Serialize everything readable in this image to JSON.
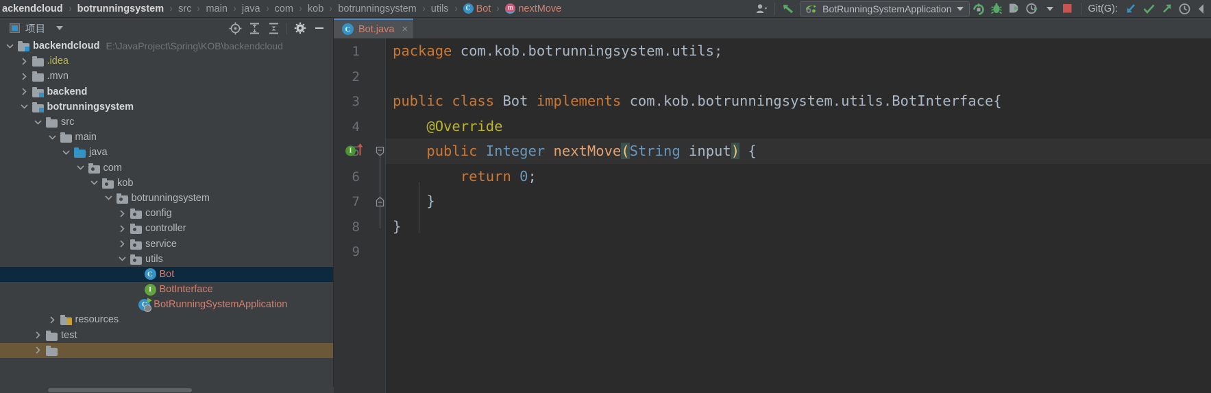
{
  "breadcrumb": {
    "items": [
      {
        "label": "ackendcloud",
        "style": "bold",
        "icon": null
      },
      {
        "label": "botrunningsystem",
        "style": "bold",
        "icon": null
      },
      {
        "label": "src",
        "style": "plain",
        "icon": null
      },
      {
        "label": "main",
        "style": "plain",
        "icon": null
      },
      {
        "label": "java",
        "style": "plain",
        "icon": null
      },
      {
        "label": "com",
        "style": "plain",
        "icon": null
      },
      {
        "label": "kob",
        "style": "plain",
        "icon": null
      },
      {
        "label": "botrunningsystem",
        "style": "plain",
        "icon": null
      },
      {
        "label": "utils",
        "style": "plain",
        "icon": null
      },
      {
        "label": "Bot",
        "style": "file",
        "icon": "class-icon"
      },
      {
        "label": "nextMove",
        "style": "method",
        "icon": "method-icon"
      }
    ],
    "separator": "›"
  },
  "toolbar": {
    "icons": [
      "user-avatar-icon",
      "dropdown-caret-icon",
      "update-project-icon"
    ],
    "run_config": {
      "name": "BotRunningSystemApplication",
      "icon": "spring-boot-icon"
    },
    "actions": [
      "run-icon",
      "debug-icon",
      "run-with-coverage-icon",
      "profile-icon",
      "profile-caret-icon",
      "stop-icon"
    ],
    "git_label": "Git(G):",
    "git_actions": [
      "update-project-icon",
      "commit-icon",
      "push-icon",
      "history-icon",
      "rollback-icon"
    ]
  },
  "project_panel": {
    "title": "项目",
    "icons": [
      "project-view-icon",
      "panel-caret-icon",
      "locate-icon",
      "expand-all-icon",
      "collapse-all-icon",
      "settings-gear-icon",
      "hide-panel-icon"
    ],
    "tree": [
      {
        "depth": 0,
        "label": "backendcloud",
        "path": "E:\\JavaProject\\Spring\\KOB\\backendcloud",
        "icon": "module-folder-icon",
        "arrow": "down",
        "style": "bold"
      },
      {
        "depth": 1,
        "label": ".idea",
        "icon": "folder-icon",
        "arrow": "right",
        "style": "yellow"
      },
      {
        "depth": 1,
        "label": ".mvn",
        "icon": "folder-icon",
        "arrow": "right",
        "style": "plain"
      },
      {
        "depth": 1,
        "label": "backend",
        "icon": "module-folder-icon",
        "arrow": "right",
        "style": "bold"
      },
      {
        "depth": 1,
        "label": "botrunningsystem",
        "icon": "module-folder-icon",
        "arrow": "down",
        "style": "bold"
      },
      {
        "depth": 2,
        "label": "src",
        "icon": "folder-icon",
        "arrow": "down",
        "style": "plain"
      },
      {
        "depth": 3,
        "label": "main",
        "icon": "folder-icon",
        "arrow": "down",
        "style": "plain"
      },
      {
        "depth": 4,
        "label": "java",
        "icon": "source-root-icon",
        "arrow": "down",
        "style": "plain"
      },
      {
        "depth": 5,
        "label": "com",
        "icon": "package-icon",
        "arrow": "down",
        "style": "plain"
      },
      {
        "depth": 6,
        "label": "kob",
        "icon": "package-icon",
        "arrow": "down",
        "style": "plain"
      },
      {
        "depth": 7,
        "label": "botrunningsystem",
        "icon": "package-icon",
        "arrow": "down",
        "style": "plain"
      },
      {
        "depth": 8,
        "label": "config",
        "icon": "package-icon",
        "arrow": "right",
        "style": "plain"
      },
      {
        "depth": 8,
        "label": "controller",
        "icon": "package-icon",
        "arrow": "right",
        "style": "plain"
      },
      {
        "depth": 8,
        "label": "service",
        "icon": "package-icon",
        "arrow": "right",
        "style": "plain"
      },
      {
        "depth": 8,
        "label": "utils",
        "icon": "package-icon",
        "arrow": "down",
        "style": "plain"
      },
      {
        "depth": 9,
        "label": "Bot",
        "icon": "java-class-icon",
        "arrow": "none",
        "style": "red",
        "selected": true
      },
      {
        "depth": 9,
        "label": "BotInterface",
        "icon": "java-interface-icon",
        "arrow": "none",
        "style": "red"
      },
      {
        "depth": 8.6,
        "label": "BotRunningSystemApplication",
        "icon": "spring-class-icon",
        "arrow": "none",
        "style": "red"
      },
      {
        "depth": 3,
        "label": "resources",
        "icon": "resource-folder-icon",
        "arrow": "right",
        "style": "plain"
      },
      {
        "depth": 2,
        "label": "test",
        "icon": "folder-icon",
        "arrow": "right",
        "style": "plain"
      },
      {
        "depth": 2,
        "label": "",
        "icon": "folder-icon",
        "arrow": "right",
        "style": "plain",
        "partial": true
      }
    ]
  },
  "editor": {
    "tab": {
      "label": "Bot.java",
      "icon": "java-class-icon",
      "close": "×"
    },
    "lines": [
      {
        "n": "1",
        "tokens": [
          {
            "t": "package ",
            "c": "kw"
          },
          {
            "t": "com.kob.botrunningsystem.utils;",
            "c": "cls"
          }
        ]
      },
      {
        "n": "2",
        "tokens": []
      },
      {
        "n": "3",
        "tokens": [
          {
            "t": "public class ",
            "c": "kw"
          },
          {
            "t": "Bot ",
            "c": "cls"
          },
          {
            "t": "implements ",
            "c": "kw"
          },
          {
            "t": "com.kob.botrunningsystem.utils.BotInterface{",
            "c": "cls"
          }
        ]
      },
      {
        "n": "4",
        "tokens": [
          {
            "t": "    @Override",
            "c": "anno"
          }
        ]
      },
      {
        "n": "5",
        "tokens": [
          {
            "t": "    ",
            "c": "cls"
          },
          {
            "t": "public ",
            "c": "kw"
          },
          {
            "t": "Integer ",
            "c": "num"
          },
          {
            "t": "nextMove",
            "c": "mname"
          },
          {
            "t": "(",
            "c": "brk"
          },
          {
            "t": "String",
            "c": "num"
          },
          {
            "t": " input",
            "c": "cls"
          },
          {
            "t": ")",
            "c": "brk"
          },
          {
            "t": " {",
            "c": "cls"
          }
        ],
        "current": true,
        "gutter": {
          "impl": "I",
          "arrow": "implements-up-arrow",
          "fold": "fold-collapse-icon"
        }
      },
      {
        "n": "6",
        "tokens": [
          {
            "t": "        ",
            "c": "cls"
          },
          {
            "t": "return ",
            "c": "kw"
          },
          {
            "t": "0",
            "c": "num"
          },
          {
            "t": ";",
            "c": "cls"
          }
        ]
      },
      {
        "n": "7",
        "tokens": [
          {
            "t": "    }",
            "c": "cls"
          }
        ],
        "gutter": {
          "fold": "fold-end-icon"
        }
      },
      {
        "n": "8",
        "tokens": [
          {
            "t": "}",
            "c": "cls"
          }
        ]
      },
      {
        "n": "9",
        "tokens": []
      }
    ]
  },
  "colors": {
    "background": "#3c3f41",
    "editor_bg": "#2b2b2b",
    "gutter_bg": "#313335",
    "selection": "#0d293e",
    "keyword": "#cc7832",
    "annotation": "#bbb529",
    "method": "#e0a070",
    "type": "#6897bb",
    "text": "#a9b7c6",
    "modified_file": "#cf8070",
    "accent_blue": "#3592c4",
    "accent_green": "#62a23f",
    "tab_underline": "#4a88c7"
  }
}
